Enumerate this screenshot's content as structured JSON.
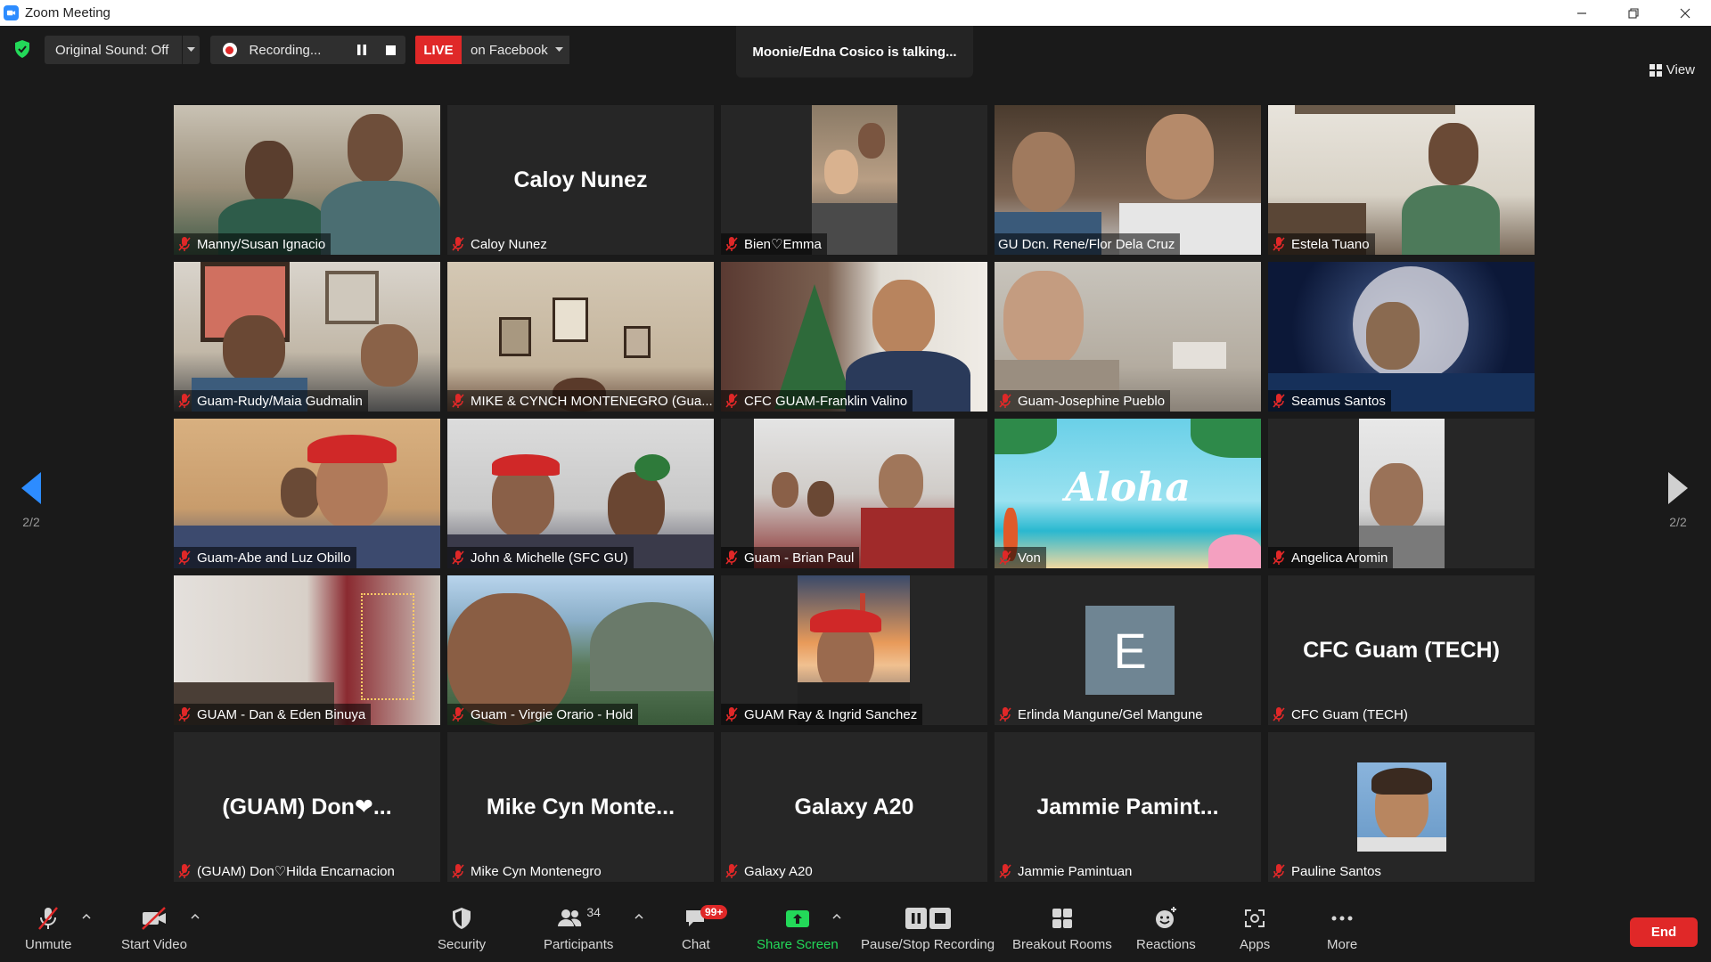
{
  "window": {
    "title": "Zoom Meeting",
    "controls": [
      "minimize-icon",
      "restore-icon",
      "close-icon"
    ]
  },
  "topbar": {
    "sound_label": "Original Sound: Off",
    "recording_label": "Recording...",
    "live_label": "LIVE",
    "live_destination": "on Facebook",
    "talking_indicator": "Moonie/Edna Cosico is talking...",
    "view_label": "View"
  },
  "pagination": {
    "left_label": "2/2",
    "right_label": "2/2"
  },
  "participants": [
    {
      "name": "Manny/Susan Ignacio",
      "display": "video"
    },
    {
      "name": "Caloy Nunez",
      "display": "name",
      "big_name": "Caloy Nunez"
    },
    {
      "name": "Bien♡Emma",
      "display": "video"
    },
    {
      "name": "GU Dcn. Rene/Flor Dela Cruz",
      "display": "video"
    },
    {
      "name": "Estela Tuano",
      "display": "video"
    },
    {
      "name": "Guam-Rudy/Maia Gudmalin",
      "display": "video"
    },
    {
      "name": "MIKE & CYNCH MONTENEGRO (Gua...",
      "display": "video"
    },
    {
      "name": "CFC GUAM-Franklin Valino",
      "display": "video"
    },
    {
      "name": "Guam-Josephine Pueblo",
      "display": "video"
    },
    {
      "name": "Seamus Santos",
      "display": "video"
    },
    {
      "name": "Guam-Abe and Luz Obillo",
      "display": "video"
    },
    {
      "name": "John & Michelle (SFC GU)",
      "display": "video"
    },
    {
      "name": "Guam - Brian Paul",
      "display": "video"
    },
    {
      "name": "Von",
      "display": "image",
      "image_text": "Aloha"
    },
    {
      "name": "Angelica Aromin",
      "display": "video"
    },
    {
      "name": "GUAM - Dan & Eden Binuya",
      "display": "video"
    },
    {
      "name": "Guam - Virgie Orario - Hold",
      "display": "video"
    },
    {
      "name": "GUAM Ray & Ingrid Sanchez",
      "display": "video"
    },
    {
      "name": "Erlinda Mangune/Gel Mangune",
      "display": "avatar",
      "avatar_letter": "E"
    },
    {
      "name": "CFC Guam (TECH)",
      "display": "name",
      "big_name": "CFC Guam (TECH)"
    },
    {
      "name": "(GUAM) Don♡Hilda Encarnacion",
      "display": "name",
      "big_name": "(GUAM)  Don❤..."
    },
    {
      "name": "Mike Cyn Montenegro",
      "display": "name",
      "big_name": "Mike  Cyn  Monte..."
    },
    {
      "name": "Galaxy A20",
      "display": "name",
      "big_name": "Galaxy A20"
    },
    {
      "name": "Jammie Pamintuan",
      "display": "name",
      "big_name": "Jammie  Pamint..."
    },
    {
      "name": "Pauline Santos",
      "display": "photo"
    }
  ],
  "toolbar": {
    "unmute": "Unmute",
    "start_video": "Start Video",
    "security": "Security",
    "participants": "Participants",
    "participants_count": "34",
    "chat": "Chat",
    "chat_badge": "99+",
    "share_screen": "Share Screen",
    "pause_stop_recording": "Pause/Stop Recording",
    "breakout_rooms": "Breakout Rooms",
    "reactions": "Reactions",
    "apps": "Apps",
    "more": "More",
    "end": "End"
  },
  "colors": {
    "background": "#1a1a1a",
    "tile": "#262626",
    "accent_blue": "#2d8cff",
    "share_green": "#23d959",
    "end_red": "#e02828",
    "live_red": "#e02828",
    "muted_mic_red": "#e02828"
  }
}
